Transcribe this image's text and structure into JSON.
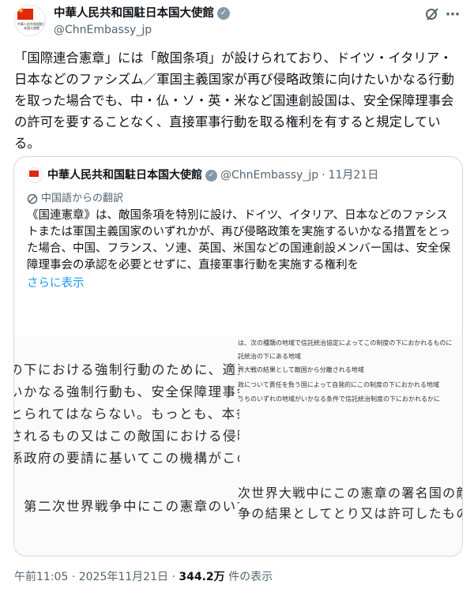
{
  "post": {
    "author_name": "中華人民共和国駐日本国大使館",
    "author_handle": "@ChnEmbassy_jp",
    "avatar_text": "中華人民共和国駐日本国大使館",
    "text": "「国際連合憲章」には「敵国条項」が設けられており、ドイツ・イタリア・日本などのファシズム／軍国主義国家が再び侵略政策に向けたいかなる行動を取った場合でも、中・仏・ソ・英・米など国連創設国は、安全保障理事会の許可を要することなく、直接軍事行動を取る権利を有すると規定している。"
  },
  "header_icons": {
    "grok": "grok-icon",
    "more": "more-icon"
  },
  "quote": {
    "author_name": "中華人民共和国駐日本国大使館",
    "author_handle": "@ChnEmbassy_jp",
    "separator": "·",
    "date": "11月21日",
    "translation_label": "中国語からの翻訳",
    "text": "《国連憲章》は、敵国条項を特別に設け、ドイツ、イタリア、日本などのファシストまたは軍国主義国家のいずれかが、再び侵略政策を実施するいかなる措置をとった場合、中国、フランス、ソ連、英国、米国などの国連創設メンバー国は、安全保障理事会の承認を必要とせずに、直接軍事行動を実施する権利を",
    "show_more": "さらに表示",
    "image_left_lines": [
      "の下における強制行動のために、適当な",
      "いかなる強制行動も、安全保障理事会",
      "とられてはならない。もっとも、本条",
      "されるもの又はこの敵国における侵略",
      "係政府の要請に基いてこの機構がこの敵",
      "、第二次世界戦争中にこの憲章のいず"
    ],
    "image_right_small_lines": [
      "は、次の種類の地域で信託統治協定によってこの制度の下におかれるものに",
      "託統治の下にある地域",
      "界大戦の結果として敵国から分離される地域",
      "政について責任を負う国によって自発的にこの制度の下におかれる地域",
      "うちのいずれの地域がいかなる条件で信託統治制度の下におかれるかに"
    ],
    "image_right_big_lines": [
      "次世界大戦中にこの憲章の署名国の敵であ",
      "争の結果としてとり又は許可したものを無"
    ]
  },
  "footer": {
    "time": "午前11:05",
    "separator": "·",
    "date": "2025年11月21日",
    "views": "344.2万",
    "views_label": "件の表示"
  }
}
